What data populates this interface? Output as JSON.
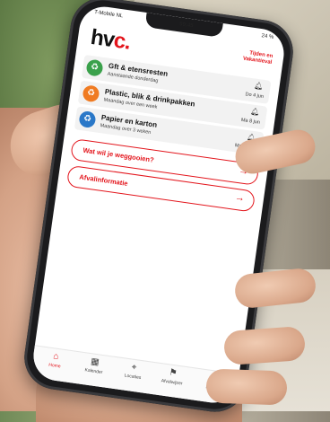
{
  "status_bar": {
    "carrier": "T-Mobile NL",
    "time": "09:45",
    "battery": "24 %"
  },
  "header": {
    "logo_main": "hv",
    "logo_accent": "c.",
    "top_right_link": "Tijden en Vakantieval"
  },
  "colors": {
    "brand_red": "#e3141b",
    "gft_green": "#3aa14b",
    "plastic_orange": "#f07b22",
    "paper_blue": "#2a78c8"
  },
  "pickups": [
    {
      "title": "Gft & etensresten",
      "subtitle": "Aanstaande donderdag",
      "date": "Do 4 jun",
      "icon": "gft-bin-icon",
      "bell": "bell-icon"
    },
    {
      "title": "Plastic, blik & drinkpakken",
      "subtitle": "Maandag over een week",
      "date": "Ma 8 jun",
      "icon": "plastic-bin-icon",
      "bell": "bell-icon"
    },
    {
      "title": "Papier en karton",
      "subtitle": "Maandag over 3 weken",
      "date": "Ma 22 jun",
      "icon": "paper-bin-icon",
      "bell": "bell-icon"
    }
  ],
  "actions": [
    {
      "label": "Wat wil je weggooien?",
      "arrow": "→"
    },
    {
      "label": "Afvalinformatie",
      "arrow": "→"
    }
  ],
  "bottom_nav": [
    {
      "label": "Home",
      "icon": "home-icon",
      "active": true
    },
    {
      "label": "Kalender",
      "icon": "calendar-icon",
      "active": false
    },
    {
      "label": "Locaties",
      "icon": "location-pin-icon",
      "active": false
    },
    {
      "label": "Afvalwijzer",
      "icon": "signpost-icon",
      "active": false
    },
    {
      "label": "Meer",
      "icon": "menu-icon",
      "active": false
    }
  ]
}
